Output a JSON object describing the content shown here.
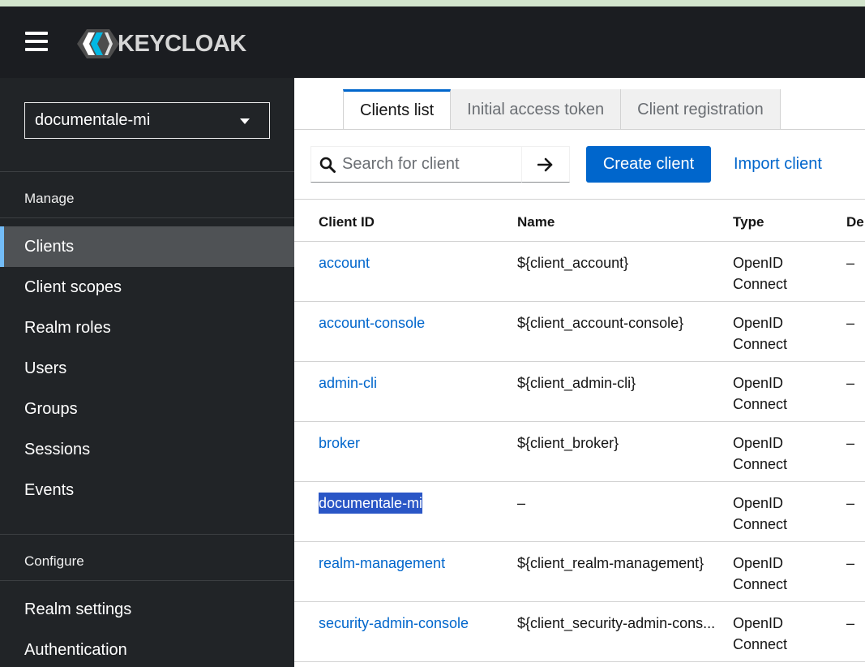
{
  "header": {
    "logo_text": "KEYCLOAK",
    "menu_icon": "hamburger-icon"
  },
  "sidebar": {
    "realm": "documentale-mi",
    "sections": [
      {
        "label": "Manage"
      },
      {
        "label": "Configure"
      }
    ],
    "manage_items": [
      {
        "label": "Clients",
        "active": true
      },
      {
        "label": "Client scopes"
      },
      {
        "label": "Realm roles"
      },
      {
        "label": "Users"
      },
      {
        "label": "Groups"
      },
      {
        "label": "Sessions"
      },
      {
        "label": "Events"
      }
    ],
    "configure_items": [
      {
        "label": "Realm settings"
      },
      {
        "label": "Authentication"
      }
    ]
  },
  "tabs": [
    {
      "label": "Clients list",
      "active": true
    },
    {
      "label": "Initial access token"
    },
    {
      "label": "Client registration"
    }
  ],
  "toolbar": {
    "search_placeholder": "Search for client",
    "create_label": "Create client",
    "import_label": "Import client"
  },
  "table": {
    "columns": [
      "Client ID",
      "Name",
      "Type",
      "De"
    ],
    "rows": [
      {
        "client_id": "account",
        "name": "${client_account}",
        "type": "OpenID Connect",
        "description": "–"
      },
      {
        "client_id": "account-console",
        "name": "${client_account-console}",
        "type": "OpenID Connect",
        "description": "–"
      },
      {
        "client_id": "admin-cli",
        "name": "${client_admin-cli}",
        "type": "OpenID Connect",
        "description": "–"
      },
      {
        "client_id": "broker",
        "name": "${client_broker}",
        "type": "OpenID Connect",
        "description": "–"
      },
      {
        "client_id": "documentale-mi",
        "name": "–",
        "type": "OpenID Connect",
        "description": "–",
        "selected": true
      },
      {
        "client_id": "realm-management",
        "name": "${client_realm-management}",
        "type": "OpenID Connect",
        "description": "–"
      },
      {
        "client_id": "security-admin-console",
        "name": "${client_security-admin-cons...",
        "type": "OpenID Connect",
        "description": "–"
      }
    ]
  },
  "colors": {
    "masthead": "#1b1d21",
    "sidebar": "#212427",
    "active_nav": "#4f5255",
    "accent": "#0066cc",
    "active_indicator": "#73bcf7"
  }
}
